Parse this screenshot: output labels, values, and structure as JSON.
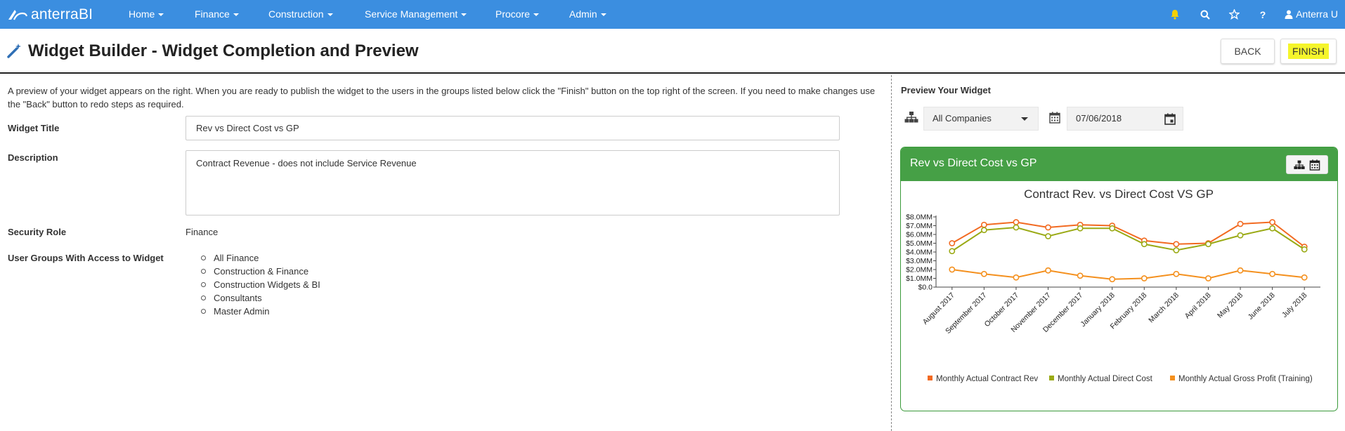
{
  "app": {
    "brand": "anterraBI",
    "nav": [
      "Home",
      "Finance",
      "Construction",
      "Service Management",
      "Procore",
      "Admin"
    ],
    "user": "Anterra U"
  },
  "header": {
    "title": "Widget Builder - Widget Completion and Preview",
    "back_label": "BACK",
    "finish_label": "FINISH"
  },
  "form": {
    "intro": "A preview of your widget appears on the right. When you are ready to publish the widget to the users in the groups listed below click the \"Finish\" button on the top right of the screen. If you need to make changes use the \"Back\" button to redo steps as required.",
    "widget_title_label": "Widget Title",
    "widget_title_value": "Rev vs Direct Cost vs GP",
    "description_label": "Description",
    "description_value": "Contract Revenue - does not include Service Revenue",
    "security_role_label": "Security Role",
    "security_role_value": "Finance",
    "user_groups_label": "User Groups With Access to Widget",
    "user_groups": [
      "All Finance",
      "Construction & Finance",
      "Construction Widgets & BI",
      "Consultants",
      "Master Admin"
    ]
  },
  "preview": {
    "label": "Preview Your Widget",
    "company": "All Companies",
    "date": "07/06/2018",
    "widget_title": "Rev vs Direct Cost vs GP"
  },
  "colors": {
    "nav_bg": "#3b8ee0",
    "widget_header": "#46a046",
    "series_rev": "#f26a21",
    "series_cost": "#9aaa15",
    "series_gp": "#f4901e",
    "highlight": "#f5f52b"
  },
  "chart_data": {
    "type": "line",
    "title": "Contract Rev. vs Direct Cost VS GP",
    "categories": [
      "August 2017",
      "September 2017",
      "October 2017",
      "November 2017",
      "December 2017",
      "January 2018",
      "February 2018",
      "March 2018",
      "April 2018",
      "May 2018",
      "June 2018",
      "July 2018"
    ],
    "ytick_labels": [
      "$0.0",
      "$1.0MM",
      "$2.0MM",
      "$3.0MM",
      "$4.0MM",
      "$5.0MM",
      "$6.0MM",
      "$7.0MM",
      "$8.0MM"
    ],
    "ylim": [
      0,
      8
    ],
    "legend_position": "bottom",
    "series": [
      {
        "name": "Monthly Actual Contract Rev",
        "values": [
          5.0,
          7.1,
          7.4,
          6.8,
          7.1,
          7.0,
          5.3,
          4.9,
          5.0,
          7.2,
          7.4,
          4.6
        ]
      },
      {
        "name": "Monthly Actual Direct Cost",
        "values": [
          4.1,
          6.5,
          6.8,
          5.8,
          6.7,
          6.7,
          4.9,
          4.2,
          4.9,
          5.9,
          6.7,
          4.3
        ]
      },
      {
        "name": "Monthly Actual Gross Profit (Training)",
        "values": [
          2.0,
          1.5,
          1.1,
          1.9,
          1.3,
          0.9,
          1.0,
          1.5,
          1.0,
          1.9,
          1.5,
          1.1
        ]
      }
    ]
  }
}
